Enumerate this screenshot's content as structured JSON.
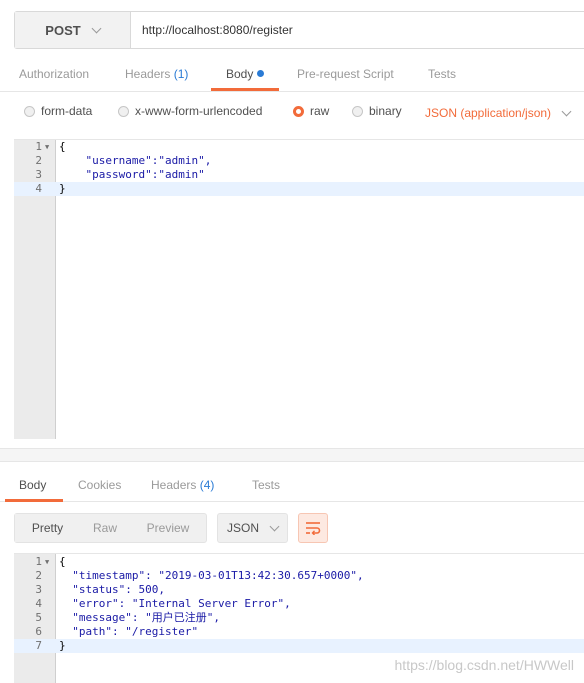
{
  "request": {
    "method": "POST",
    "url": "http://localhost:8080/register"
  },
  "request_tabs": [
    {
      "label": "Authorization"
    },
    {
      "label": "Headers",
      "count": "(1)"
    },
    {
      "label": "Body"
    },
    {
      "label": "Pre-request Script"
    },
    {
      "label": "Tests"
    }
  ],
  "body_types": [
    {
      "label": "form-data",
      "selected": false
    },
    {
      "label": "x-www-form-urlencoded",
      "selected": false
    },
    {
      "label": "raw",
      "selected": true
    },
    {
      "label": "binary",
      "selected": false
    }
  ],
  "content_type": "JSON (application/json)",
  "request_body": {
    "line_numbers": [
      "1",
      "2",
      "3",
      "4"
    ],
    "lines": [
      "{",
      "    \"username\":\"admin\",",
      "    \"password\":\"admin\"",
      "}"
    ]
  },
  "response_tabs": [
    {
      "label": "Body"
    },
    {
      "label": "Cookies"
    },
    {
      "label": "Headers",
      "count": "(4)"
    },
    {
      "label": "Tests"
    }
  ],
  "response_view": {
    "modes": [
      "Pretty",
      "Raw",
      "Preview"
    ],
    "format": "JSON"
  },
  "response_body": {
    "line_numbers": [
      "1",
      "2",
      "3",
      "4",
      "5",
      "6",
      "7"
    ],
    "lines": [
      "{",
      "  \"timestamp\": \"2019-03-01T13:42:30.657+0000\",",
      "  \"status\": 500,",
      "  \"error\": \"Internal Server Error\",",
      "  \"message\": \"用户已注册\",",
      "  \"path\": \"/register\"",
      "}"
    ]
  },
  "watermark": "https://blog.csdn.net/HWWell",
  "colors": {
    "accent": "#f26b3a",
    "count_blue": "#2a7bd5"
  }
}
